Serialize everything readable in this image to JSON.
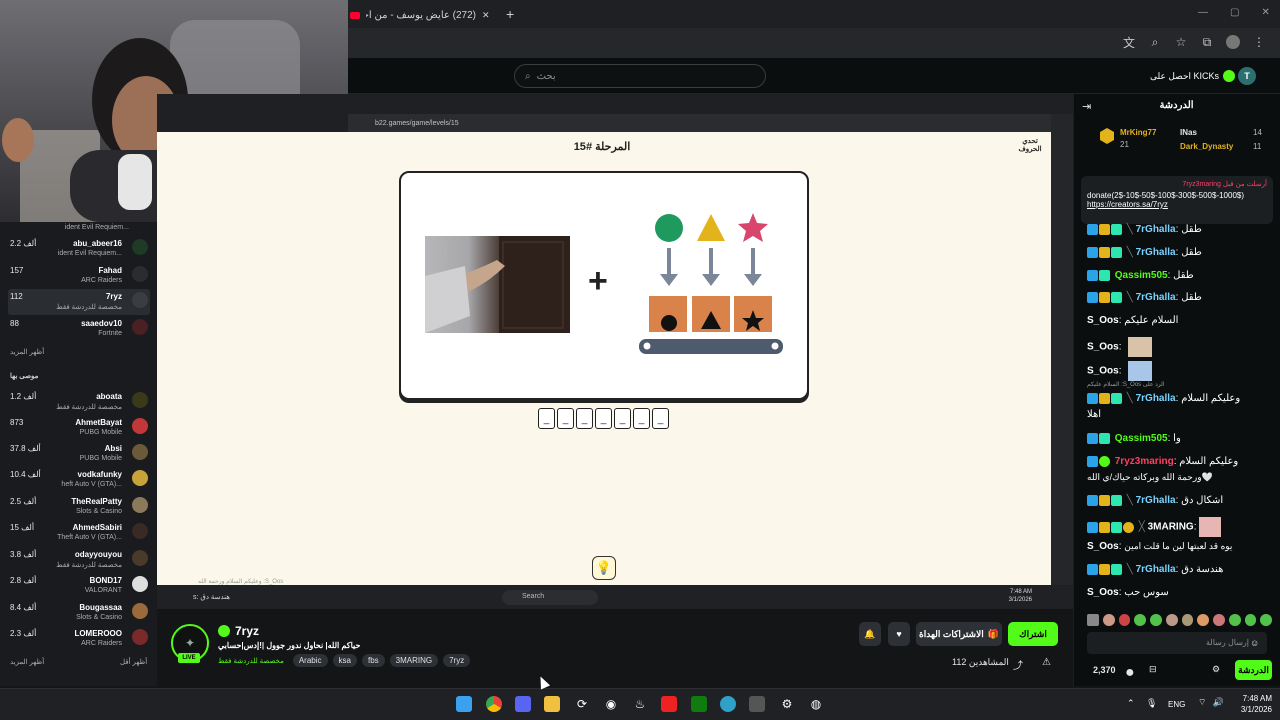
{
  "browser": {
    "tab_title": "(272) عايض يوسف - من أجل ال",
    "new_tab": "+",
    "minimize": "—",
    "restore": "▢",
    "close": "✕"
  },
  "kick_header": {
    "search_placeholder": "بحث",
    "get_kicks": "احصل على KICKs",
    "user_initial": "T"
  },
  "sidebar": {
    "channels_top": [
      {
        "name": "abu_abeer16",
        "viewers": "2.2 ألف",
        "game": "...ident Evil Requiem"
      },
      {
        "name": "Fahad",
        "viewers": "157",
        "game": "ARC Raiders"
      },
      {
        "name": "7ryz",
        "viewers": "112",
        "game": "مخصصة للدردشة فقط"
      },
      {
        "name": "saaedov10",
        "viewers": "88",
        "game": "Fortnite"
      }
    ],
    "top_game_hint": "...ident Evil Requiem",
    "show_more": "أظهر المزيد",
    "recommended_heading": "موصى بها",
    "recommended": [
      {
        "name": "aboata",
        "viewers": "1.2 ألف",
        "game": "مخصصة للدردشة فقط"
      },
      {
        "name": "AhmetBayat",
        "viewers": "873",
        "game": "PUBG Mobile"
      },
      {
        "name": "Absi",
        "viewers": "37.8 ألف",
        "game": "PUBG Mobile"
      },
      {
        "name": "vodkafunky",
        "viewers": "10.4 ألف",
        "game": "...heft Auto V (GTA)"
      },
      {
        "name": "TheRealPatty",
        "viewers": "2.5 ألف",
        "game": "Slots & Casino"
      },
      {
        "name": "AhmedSabiri",
        "viewers": "15 ألف",
        "game": "...Theft Auto V (GTA)"
      },
      {
        "name": "odayyouyou",
        "viewers": "3.8 ألف",
        "game": "مخصصة للدردشة فقط"
      },
      {
        "name": "BOND17",
        "viewers": "2.8 ألف",
        "game": "VALORANT"
      },
      {
        "name": "Bougassaa",
        "viewers": "8.4 ألف",
        "game": "Slots & Casino"
      },
      {
        "name": "LOMEROOO",
        "viewers": "2.3 ألف",
        "game": "ARC Raiders"
      }
    ],
    "show_more_2": "أظهر المزيد",
    "show_less": "أظهر أقل"
  },
  "game": {
    "url": "b22.games/game/levels/15",
    "level_title": "المرحلة #15",
    "logo": "تحدي الحروف",
    "answer_boxes": [
      "_",
      "_",
      "_",
      "_",
      "_",
      "_",
      "_"
    ],
    "hint_icon": "💡",
    "caption": "هندسة دق :s",
    "caption_small": "S_Oos: وعليكم السلام ورحمة الله",
    "taskbar_search": "Search"
  },
  "stream": {
    "streamer": "7ryz",
    "title": "حياكم الله| نحاول ندور جوول |!إدس|حسابي",
    "category": "مخصصة للدردشة فقط",
    "tags": [
      "Arabic",
      "ksa",
      "fbs",
      "3MARING",
      "7ryz"
    ],
    "live_label": "LIVE",
    "viewers_label": "المشاهدين 112",
    "follow_label": "اشتراك",
    "gift_label": "الاشتراكات الهداة"
  },
  "chat": {
    "header": "الدردشة",
    "leaderboard": [
      {
        "name": "MrKing77",
        "score": "21"
      },
      {
        "name": "INas",
        "score": "14"
      },
      {
        "name": "Dark_Dynasty",
        "score": "11"
      }
    ],
    "pinned_author": "أرسلت من قبل 7ryz3maring",
    "pinned_text": "donate(2$-10$-50$-100$-300$-500$-1000$)",
    "pinned_link": "https://creators.sa/7ryz",
    "messages": [
      {
        "user": "7rGhalla",
        "text": "طقل",
        "color": "#7ad3ff"
      },
      {
        "user": "7rGhalla",
        "text": "طقل",
        "color": "#7ad3ff"
      },
      {
        "user": "Qassim505",
        "text": "طقل",
        "color": "#53fc18"
      },
      {
        "user": "7rGhalla",
        "text": "طقل",
        "color": "#7ad3ff"
      },
      {
        "user": "S_Oos",
        "text": "السلام عليكم",
        "color": "#ffffff"
      },
      {
        "user": "S_Oos",
        "text": "",
        "color": "#ffffff"
      },
      {
        "user": "S_Oos",
        "text": "",
        "color": "#ffffff"
      },
      {
        "user": "7rGhalla",
        "text": "وعليكم السلام",
        "color": "#7ad3ff"
      },
      {
        "user": "",
        "text": "اهلا",
        "color": "#ffffff"
      },
      {
        "user": "Qassim505",
        "text": "وا",
        "color": "#53fc18"
      },
      {
        "user": "7ryz3maring",
        "text": "وعليكم السلام",
        "color": "#ff3f63"
      },
      {
        "user": "",
        "text": "ورحمة الله وبركاته حياك/ي الله🤍",
        "color": "#ffffff"
      },
      {
        "user": "7rGhalla",
        "text": "اشكال دق",
        "color": "#7ad3ff"
      },
      {
        "user": "3MARING",
        "text": "",
        "color": "#ffffff"
      },
      {
        "user": "S_Oos",
        "text": "يوه قد لعبتها لين ما قلت امين",
        "color": "#ffffff"
      },
      {
        "user": "7rGhalla",
        "text": "هندسة دق",
        "color": "#7ad3ff"
      },
      {
        "user": "S_Oos",
        "text": "سوس حب",
        "color": "#ffffff"
      }
    ],
    "reply_hint": "الرد على S_Oos: السلام عليكم",
    "input_placeholder": "إرسال رسالة",
    "points": "2,370",
    "chat_button": "الدردشة"
  },
  "taskbar": {
    "lang": "ENG",
    "time": "7:48 AM",
    "date": "3/1/2026"
  }
}
